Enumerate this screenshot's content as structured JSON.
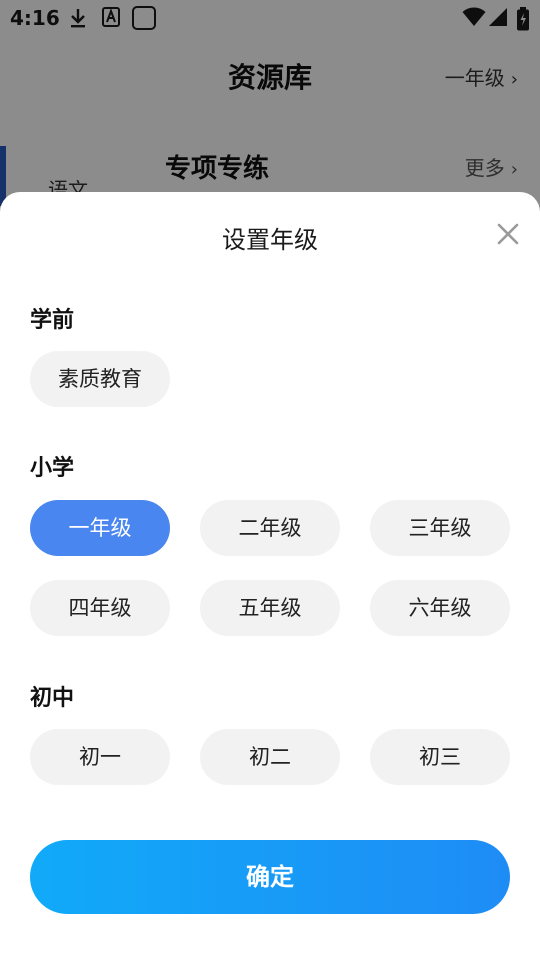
{
  "status_bar": {
    "time": "4:16",
    "icons": [
      "download-icon",
      "a-icon",
      "square-icon",
      "wifi-icon",
      "signal-icon",
      "battery-icon"
    ]
  },
  "background_page": {
    "title": "资源库",
    "grade_selector": "一年级",
    "sidebar_subject": "语文",
    "section_title": "专项专练",
    "more_link": "更多"
  },
  "dialog": {
    "title": "设置年级",
    "groups": [
      {
        "label": "学前",
        "options": [
          "素质教育"
        ]
      },
      {
        "label": "小学",
        "options": [
          "一年级",
          "二年级",
          "三年级",
          "四年级",
          "五年级",
          "六年级"
        ]
      },
      {
        "label": "初中",
        "options": [
          "初一",
          "初二",
          "初三"
        ]
      }
    ],
    "selected": "一年级",
    "confirm_label": "确定"
  },
  "colors": {
    "accent": "#4a86f0",
    "confirm_gradient_start": "#11aaf9",
    "confirm_gradient_end": "#1e8cf5",
    "chip_bg": "#f2f2f2"
  }
}
